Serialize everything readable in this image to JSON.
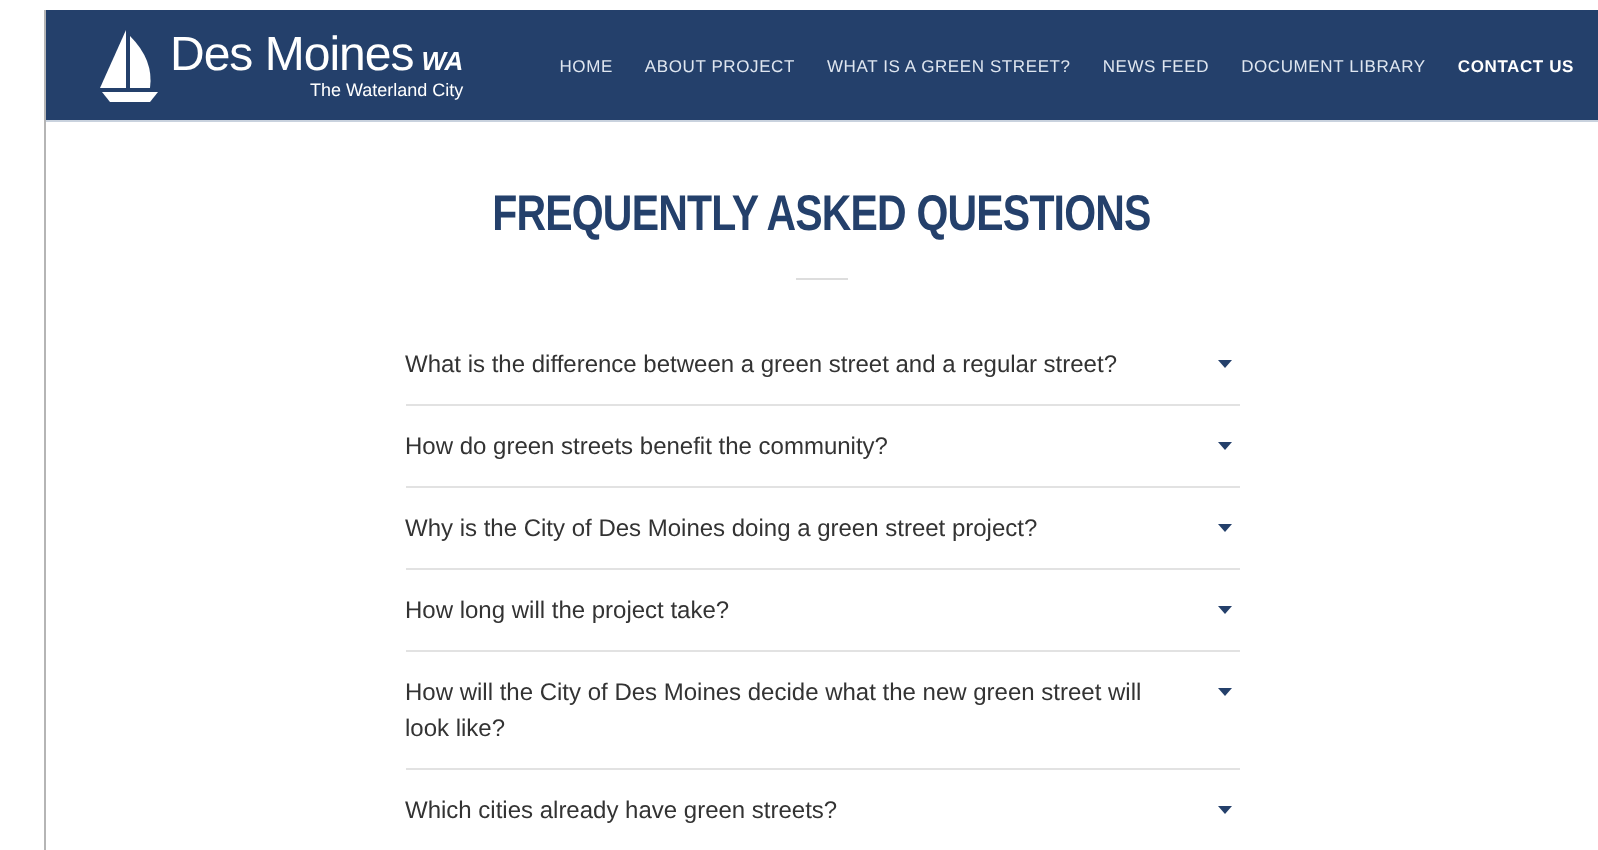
{
  "header": {
    "logo": {
      "name": "Des Moines",
      "suffix": "WA",
      "tagline": "The Waterland City"
    },
    "nav": [
      {
        "label": "HOME",
        "selected": false
      },
      {
        "label": "ABOUT PROJECT",
        "selected": false
      },
      {
        "label": "WHAT IS A GREEN STREET?",
        "selected": false
      },
      {
        "label": "NEWS FEED",
        "selected": false
      },
      {
        "label": "DOCUMENT LIBRARY",
        "selected": false
      },
      {
        "label": "CONTACT US",
        "selected": true
      }
    ]
  },
  "faq": {
    "title": "FREQUENTLY ASKED QUESTIONS",
    "items": [
      {
        "question": "What is the difference between a green street and a regular street?",
        "expanded": false
      },
      {
        "question": "How do green streets benefit the community?",
        "expanded": false
      },
      {
        "question": "Why is the City of Des Moines doing a green street project?",
        "expanded": false
      },
      {
        "question": "How long will the project take?",
        "expanded": false
      },
      {
        "question": "How will the City of Des Moines decide what the new green street will look like?",
        "expanded": false
      },
      {
        "question": "Which cities already have green streets?",
        "expanded": false
      }
    ]
  }
}
